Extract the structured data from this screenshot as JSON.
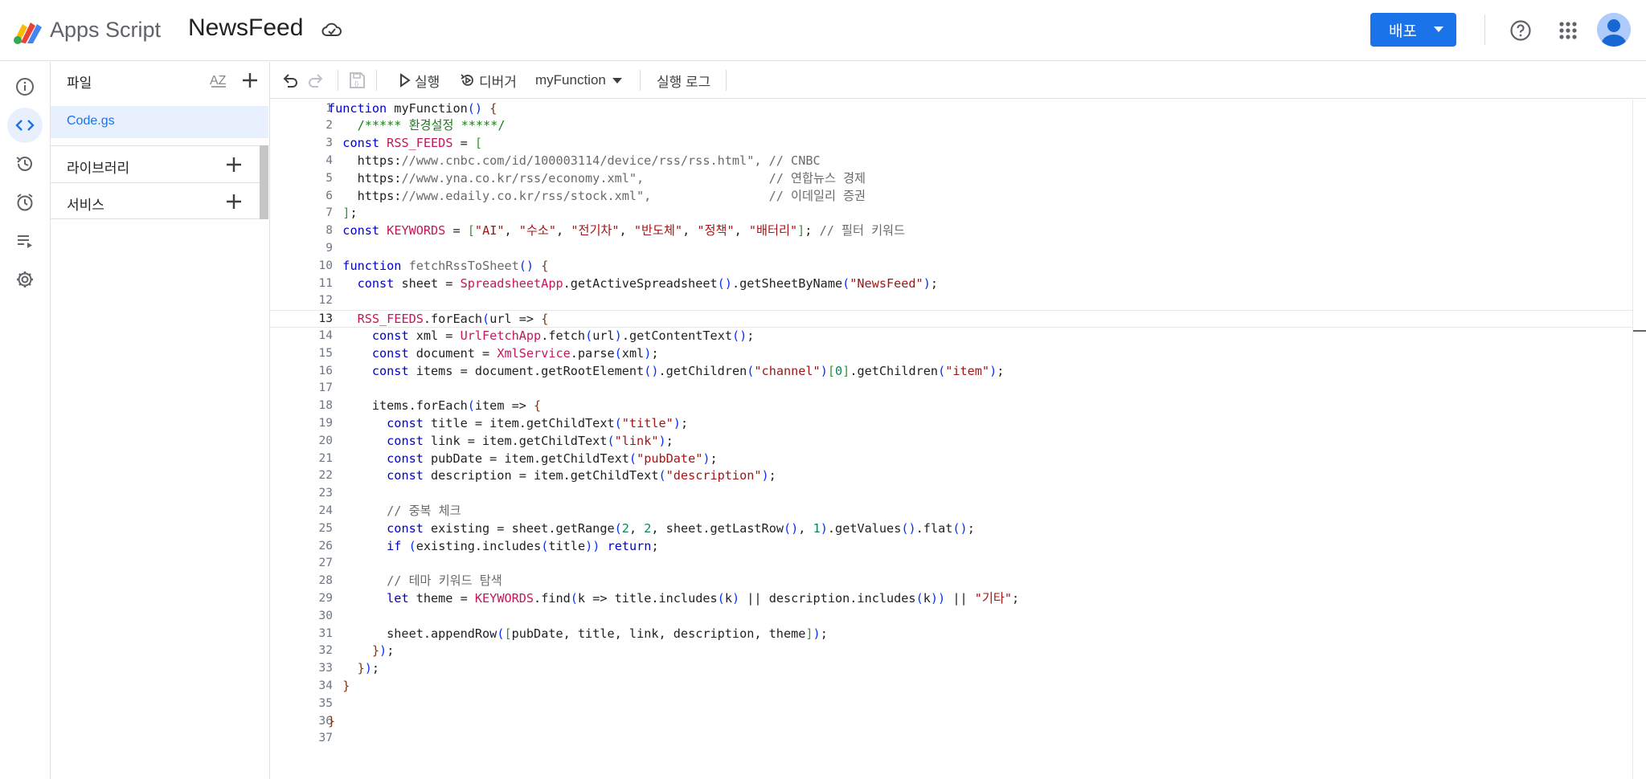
{
  "header": {
    "app_name": "Apps Script",
    "project_title": "NewsFeed",
    "deploy_label": "배포"
  },
  "files_panel": {
    "title": "파일",
    "sort_label": "AZ",
    "files": [
      {
        "name": "Code.gs"
      }
    ],
    "sections": [
      {
        "label": "라이브러리"
      },
      {
        "label": "서비스"
      }
    ]
  },
  "toolbar": {
    "run_label": "실행",
    "debug_label": "디버거",
    "function_select": "myFunction",
    "log_label": "실행 로그"
  },
  "editor": {
    "current_line": 13,
    "lines": [
      "function myFunction() {",
      "  /***** 환경설정 *****/",
      "const RSS_FEEDS = [",
      "  \"https://www.cnbc.com/id/100003114/device/rss/rss.html\", // CNBC",
      "  \"https://www.yna.co.kr/rss/economy.xml\",                 // 연합뉴스 경제",
      "  \"https://www.edaily.co.kr/rss/stock.xml\",                // 이데일리 증권",
      "];",
      "const KEYWORDS = [\"AI\", \"수소\", \"전기차\", \"반도체\", \"정책\", \"배터리\"]; // 필터 키워드",
      "",
      "function fetchRssToSheet() {",
      "  const sheet = SpreadsheetApp.getActiveSpreadsheet().getSheetByName(\"NewsFeed\");",
      "",
      "  RSS_FEEDS.forEach(url => {",
      "    const xml = UrlFetchApp.fetch(url).getContentText();",
      "    const document = XmlService.parse(xml);",
      "    const items = document.getRootElement().getChildren(\"channel\")[0].getChildren(\"item\");",
      "",
      "    items.forEach(item => {",
      "      const title = item.getChildText(\"title\");",
      "      const link = item.getChildText(\"link\");",
      "      const pubDate = item.getChildText(\"pubDate\");",
      "      const description = item.getChildText(\"description\");",
      "",
      "      // 중복 체크",
      "      const existing = sheet.getRange(2, 2, sheet.getLastRow(), 1).getValues().flat();",
      "      if (existing.includes(title)) return;",
      "",
      "      // 테마 키워드 탐색",
      "      let theme = KEYWORDS.find(k => title.includes(k) || description.includes(k)) || \"기타\";",
      "",
      "      sheet.appendRow([pubDate, title, link, description, theme]);",
      "    });",
      "  });",
      "}",
      "",
      "}",
      ""
    ]
  },
  "colors": {
    "accent": "#1a73e8",
    "keyword": "#0000cf",
    "string": "#a31515",
    "constant": "#c2185b",
    "comment": "#6a6a6a"
  },
  "icons": [
    "apps-script-logo",
    "cloud-icon",
    "help-icon",
    "apps-grid-icon",
    "info-icon",
    "code-icon",
    "history-icon",
    "clock-icon",
    "executions-icon",
    "gear-icon",
    "sort-az-icon",
    "add-icon",
    "undo-icon",
    "redo-icon",
    "save-icon",
    "play-icon",
    "debug-icon",
    "chevron-down-icon"
  ]
}
